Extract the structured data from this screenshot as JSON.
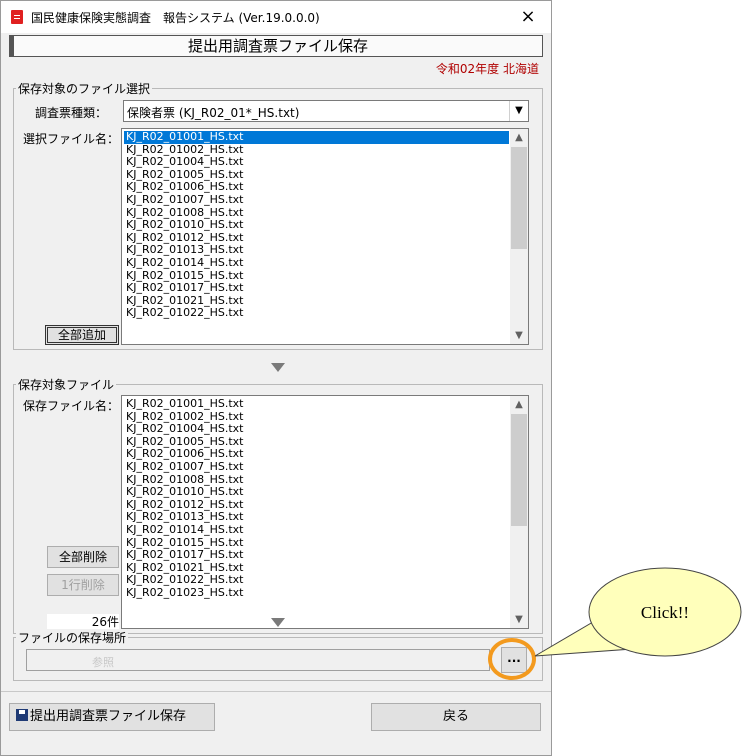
{
  "window": {
    "title": "国民健康保険実態調査　報告システム (Ver.19.0.0.0)",
    "close_glyph": "×"
  },
  "header": {
    "title": "提出用調査票ファイル保存",
    "fiscal": "令和02年度  北海道"
  },
  "selection_group": {
    "legend": "保存対象のファイル選択",
    "survey_type_label": "調査票種類：",
    "survey_type_value": "保険者票 (KJ_R02_01*_HS.txt)",
    "file_label": "選択ファイル名：",
    "files": [
      "KJ_R02_01001_HS.txt",
      "KJ_R02_01002_HS.txt",
      "KJ_R02_01004_HS.txt",
      "KJ_R02_01005_HS.txt",
      "KJ_R02_01006_HS.txt",
      "KJ_R02_01007_HS.txt",
      "KJ_R02_01008_HS.txt",
      "KJ_R02_01010_HS.txt",
      "KJ_R02_01012_HS.txt",
      "KJ_R02_01013_HS.txt",
      "KJ_R02_01014_HS.txt",
      "KJ_R02_01015_HS.txt",
      "KJ_R02_01017_HS.txt",
      "KJ_R02_01021_HS.txt",
      "KJ_R02_01022_HS.txt"
    ],
    "add_all_label": "全部追加"
  },
  "target_group": {
    "legend": "保存対象ファイル",
    "file_label": "保存ファイル名：",
    "files": [
      "KJ_R02_01001_HS.txt",
      "KJ_R02_01002_HS.txt",
      "KJ_R02_01004_HS.txt",
      "KJ_R02_01005_HS.txt",
      "KJ_R02_01006_HS.txt",
      "KJ_R02_01007_HS.txt",
      "KJ_R02_01008_HS.txt",
      "KJ_R02_01010_HS.txt",
      "KJ_R02_01012_HS.txt",
      "KJ_R02_01013_HS.txt",
      "KJ_R02_01014_HS.txt",
      "KJ_R02_01015_HS.txt",
      "KJ_R02_01017_HS.txt",
      "KJ_R02_01021_HS.txt",
      "KJ_R02_01022_HS.txt",
      "KJ_R02_01023_HS.txt"
    ],
    "delete_all_label": "全部削除",
    "delete_row_label": "1行削除",
    "count": "26件"
  },
  "location_group": {
    "legend": "ファイルの保存場所",
    "path_placeholder": "参照",
    "browse_label": "..."
  },
  "footer": {
    "save_label": "提出用調査票ファイル保存",
    "back_label": "戻る"
  },
  "callout": {
    "text": "Click!!"
  },
  "colors": {
    "selection": "#0078d7",
    "fiscal_text": "#b00000",
    "highlight_ring": "#f39a1e",
    "callout_fill": "#ffffbb"
  }
}
